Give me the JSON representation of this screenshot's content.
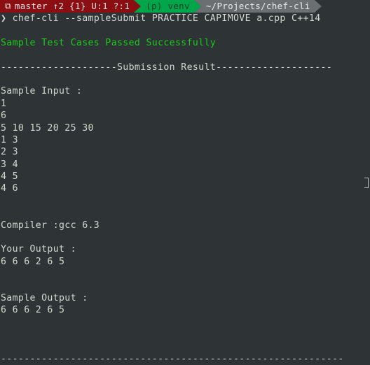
{
  "prompt_bar": {
    "git_icon": "branch-icon",
    "git_status": "master ↑2 {1} U:1 ?:1",
    "venv": "(p) venv",
    "path": "~/Projects/chef-cli",
    "colors": {
      "git_bg": "#8b0f12",
      "venv_bg": "#00a64a",
      "path_bg": "#6b6f72",
      "background": "#2e3436"
    }
  },
  "command_line": {
    "prompt_symbol": "❯",
    "command": "chef-cli --sampleSubmit PRACTICE CAPIMOVE a.cpp C++14"
  },
  "output": {
    "success_message": "Sample Test Cases Passed Successfully",
    "success_color": "#1ec81e",
    "result_header": "--------------------Submission Result--------------------",
    "sample_input_label": "Sample Input :",
    "sample_input_lines": [
      "1",
      "6",
      "5 10 15 20 25 30",
      "1 3",
      "2 3",
      "3 4",
      "4 5",
      "4 6"
    ],
    "compiler_line": "Compiler :gcc 6.3",
    "your_output_label": "Your Output :",
    "your_output_lines": [
      "6 6 6 2 6 5"
    ],
    "sample_output_label": "Sample Output :",
    "sample_output_lines": [
      "6 6 6 2 6 5"
    ],
    "footer_rule": "-----------------------------------------------------------"
  }
}
